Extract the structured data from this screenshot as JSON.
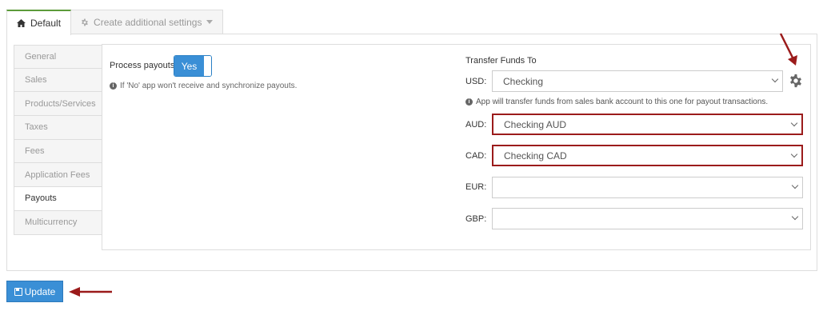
{
  "tabs": [
    {
      "label": "Default",
      "icon": "home-icon",
      "active": true
    },
    {
      "label": "Create additional settings",
      "icon": "gear-icon",
      "dropdown": true
    }
  ],
  "sidebar": {
    "items": [
      {
        "label": "General"
      },
      {
        "label": "Sales"
      },
      {
        "label": "Products/Services"
      },
      {
        "label": "Taxes"
      },
      {
        "label": "Fees"
      },
      {
        "label": "Application Fees"
      },
      {
        "label": "Payouts",
        "active": true
      },
      {
        "label": "Multicurrency"
      }
    ]
  },
  "payouts": {
    "process_label": "Process payouts",
    "toggle_value": "Yes",
    "hint": "If 'No' app won't receive and synchronize payouts."
  },
  "transfer": {
    "title": "Transfer Funds To",
    "usd_hint": "App will transfer funds from sales bank account to this one for payout transactions.",
    "rows": [
      {
        "currency": "USD:",
        "value": "Checking"
      },
      {
        "currency": "AUD:",
        "value": "Checking AUD"
      },
      {
        "currency": "CAD:",
        "value": "Checking CAD"
      },
      {
        "currency": "EUR:",
        "value": ""
      },
      {
        "currency": "GBP:",
        "value": ""
      }
    ]
  },
  "actions": {
    "update_label": "Update"
  },
  "colors": {
    "primary": "#3a8fd6",
    "highlight": "#9b1b1b",
    "tab_accent": "#5c9b3a"
  }
}
